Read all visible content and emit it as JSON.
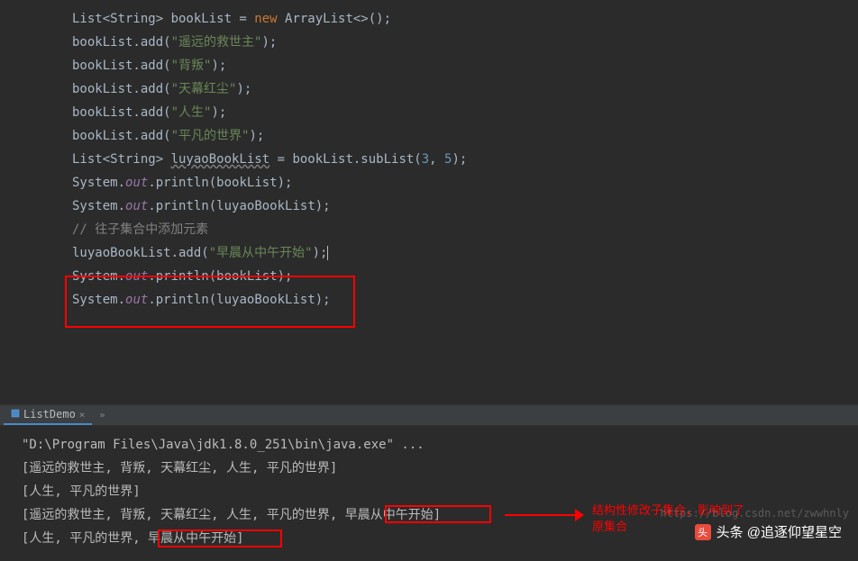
{
  "code": {
    "l1_a": "List<String> bookList = ",
    "l1_new": "new ",
    "l1_b": "ArrayList<>();",
    "l2_a": "bookList.add(",
    "l2_s": "\"遥远的救世主\"",
    "l2_c": ");",
    "l3_a": "bookList.add(",
    "l3_s": "\"背叛\"",
    "l3_c": ");",
    "l4_a": "bookList.add(",
    "l4_s": "\"天幕红尘\"",
    "l4_c": ");",
    "l5_a": "bookList.add(",
    "l5_s": "\"人生\"",
    "l5_c": ");",
    "l6_a": "bookList.add(",
    "l6_s": "\"平凡的世界\"",
    "l6_c": ");",
    "l7_a": "List<String> ",
    "l7_v": "luyaoBookList",
    "l7_b": " = bookList.subList(",
    "l7_n1": "3",
    "l7_c": ", ",
    "l7_n2": "5",
    "l7_d": ");",
    "l8_a": "System.",
    "l8_f": "out",
    "l8_b": ".println(bookList);",
    "l9_a": "System.",
    "l9_f": "out",
    "l9_b": ".println(luyaoBookList);",
    "l10": "// 往子集合中添加元素",
    "l11_a": "luyaoBookList.add(",
    "l11_s": "\"早晨从中午开始\"",
    "l11_c": ");",
    "l12_a": "System.",
    "l12_f": "out",
    "l12_b": ".println(bookList);",
    "l13_a": "System.",
    "l13_f": "out",
    "l13_b": ".println(luyaoBookList);"
  },
  "tab": {
    "name": "ListDemo",
    "close": "×",
    "arrow": "»"
  },
  "console": {
    "cmd": "\"D:\\Program Files\\Java\\jdk1.8.0_251\\bin\\java.exe\" ...",
    "o1": "[遥远的救世主, 背叛, 天幕红尘, 人生, 平凡的世界]",
    "o2": "[人生, 平凡的世界]",
    "o3": "[遥远的救世主, 背叛, 天幕红尘, 人生, 平凡的世界, 早晨从中午开始]",
    "o4": "[人生, 平凡的世界, 早晨从中午开始]"
  },
  "annotation": {
    "line1": "结构性修改子集合，影响到了",
    "line2": "原集合"
  },
  "watermark": {
    "text": "头条 @追逐仰望星空",
    "link": "https://blog.csdn.net/zwwhnly"
  }
}
